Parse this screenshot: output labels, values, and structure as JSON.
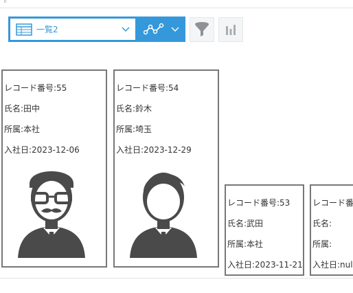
{
  "toolbar": {
    "view_name": "一覧2",
    "list_icon": "table-list-icon",
    "graph_icon": "line-graph-icon",
    "filter_icon": "filter-icon",
    "chart_icon": "bar-chart-icon",
    "accent_color": "#3498db"
  },
  "cards": [
    {
      "record": "レコード番号:55",
      "name": "氏名:田中",
      "dept": "所属:本社",
      "joined": "入社日:2023-12-06",
      "avatar": "man-glasses-mustache-avatar"
    },
    {
      "record": "レコード番号:54",
      "name": "氏名:鈴木",
      "dept": "所属:埼玉",
      "joined": "入社日:2023-12-29",
      "avatar": "man-avatar"
    },
    {
      "record": "レコード番号:53",
      "name": "氏名:武田",
      "dept": "所属:本社",
      "joined": "入社日:2023-11-21"
    },
    {
      "record": "レコード番号:",
      "name": "氏名:",
      "dept": "所属:",
      "joined": "入社日:null"
    }
  ]
}
